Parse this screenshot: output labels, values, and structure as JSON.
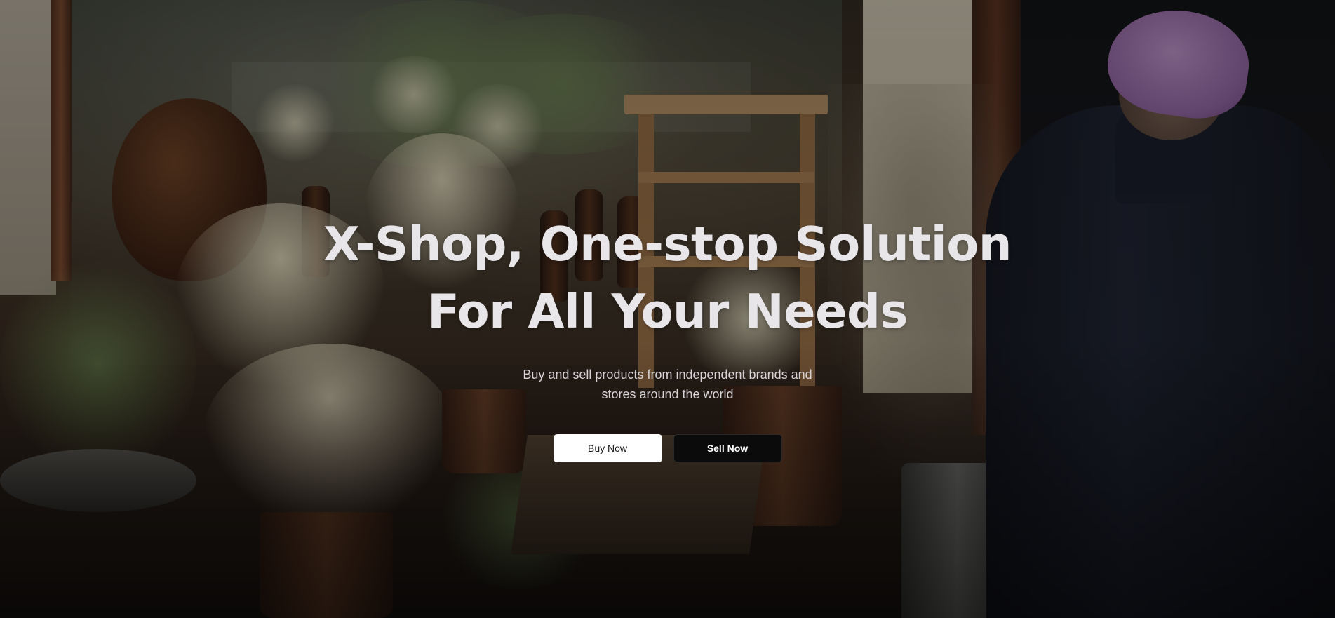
{
  "hero": {
    "headline_line1": "X-Shop, One-stop Solution",
    "headline_line2": "For All Your Needs",
    "subtitle": "Buy and sell products from independent brands and stores around the world",
    "buy_button_label": "Buy Now",
    "sell_button_label": "Sell Now"
  },
  "colors": {
    "overlay": "#000000",
    "headline": "#e9e6ea",
    "buy_button_bg": "#ffffff",
    "sell_button_bg": "#0b0b0c"
  }
}
